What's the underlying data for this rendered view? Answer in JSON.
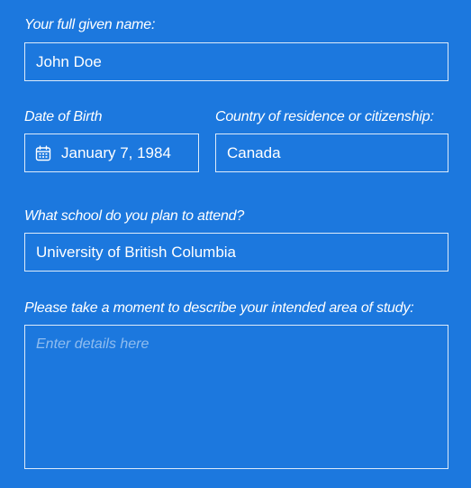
{
  "form": {
    "name": {
      "label": "Your full given name:",
      "value": "John Doe"
    },
    "dob": {
      "label": "Date of Birth",
      "value": "January 7, 1984",
      "icon": "calendar-icon"
    },
    "country": {
      "label": "Country of residence or citizenship:",
      "value": "Canada"
    },
    "school": {
      "label": "What school do you plan to attend?",
      "value": "University of British Columbia"
    },
    "study": {
      "label": "Please take a moment to describe your intended area of study:",
      "placeholder": "Enter details here",
      "value": ""
    }
  },
  "colors": {
    "background": "#1c78de",
    "text": "#ffffff",
    "border": "#ffffff"
  }
}
